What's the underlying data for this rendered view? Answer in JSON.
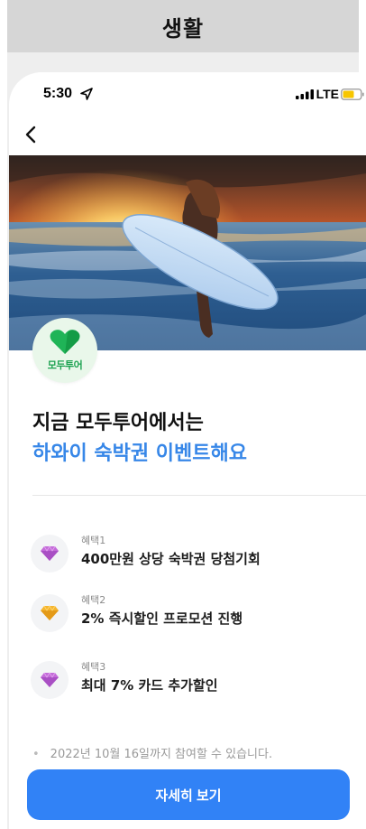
{
  "banner": {
    "title": "생활"
  },
  "status": {
    "time": "5:30",
    "network": "LTE"
  },
  "brand": {
    "logo_text": "모두투어"
  },
  "headline": {
    "line1": "지금 모두투어에서는",
    "line2": "하와이 숙박권 이벤트해요"
  },
  "benefits": [
    {
      "label": "혜택1",
      "text": "400만원 상당 숙박권 당첨기회",
      "gem_color": "#c46bd9"
    },
    {
      "label": "혜택2",
      "text": "2% 즉시할인 프로모션 진행",
      "gem_color": "#f5b52e"
    },
    {
      "label": "혜택3",
      "text": "최대 7% 카드 추가할인",
      "gem_color": "#c46bd9"
    }
  ],
  "notice": "2022년 10월 16일까지 참여할 수 있습니다.",
  "cta": {
    "label": "자세히 보기"
  },
  "colors": {
    "accent": "#3182f6",
    "headline_blue": "#3787e8",
    "brand_green": "#1aa14f"
  },
  "icons": [
    "location-arrow-icon",
    "signal-icon",
    "battery-icon",
    "back-chevron-icon",
    "heart-logo-icon",
    "gem-icon"
  ]
}
